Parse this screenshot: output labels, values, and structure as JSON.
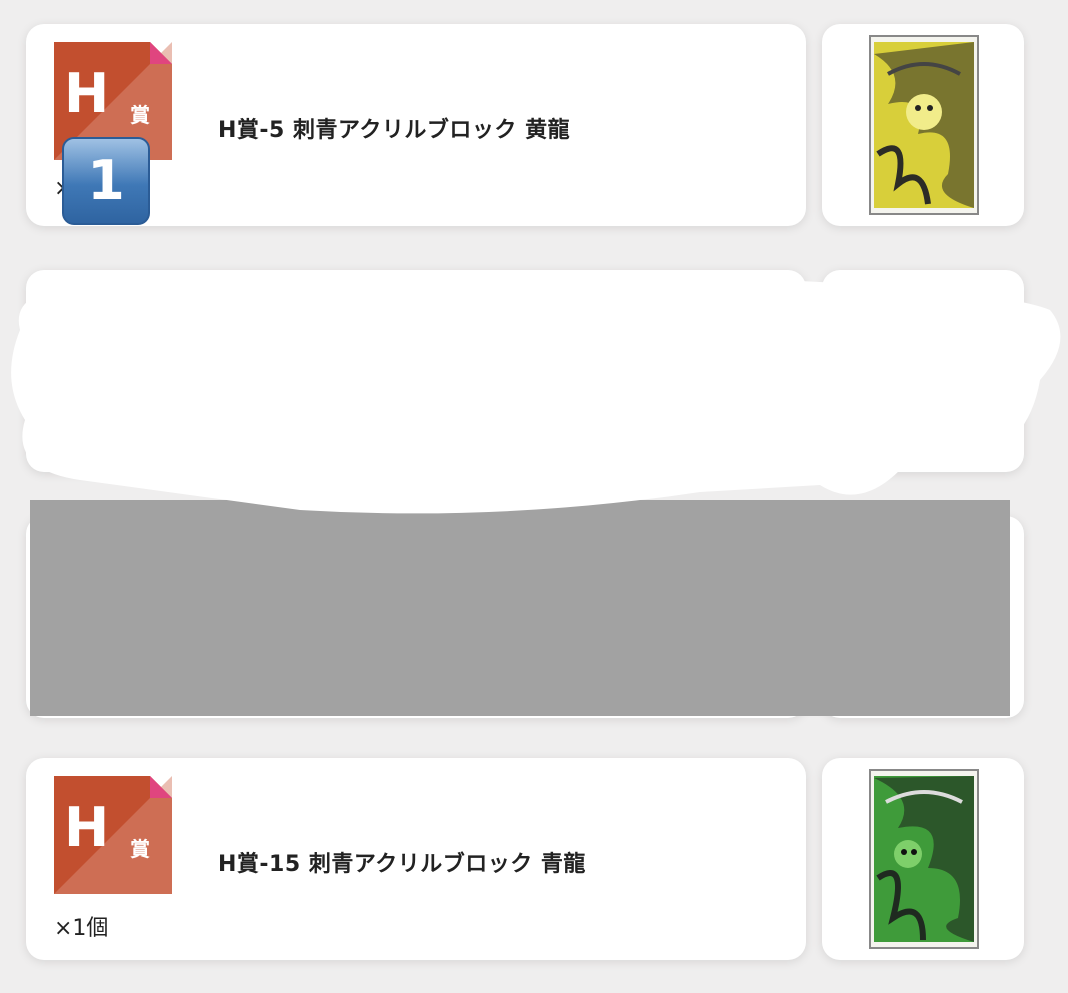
{
  "items": [
    {
      "icon_letter": "H",
      "icon_sub": "賞",
      "title": "H賞-5 刺青アクリルブロック 黄龍",
      "quantity": "",
      "quantity_visible_fragment": "×",
      "emoji_badge": "1",
      "art_icon": "yellow-dragon-acrylic-block",
      "art_colors": {
        "main": "#d8cf3a",
        "dark": "#2c2c26"
      }
    },
    {
      "redacted": true
    },
    {
      "redacted": true
    },
    {
      "icon_letter": "H",
      "icon_sub": "賞",
      "title": "H賞-15 刺青アクリルブロック 青龍",
      "quantity": "×1個",
      "art_icon": "green-dragon-acrylic-block",
      "art_colors": {
        "main": "#3f9b3a",
        "dark": "#1f2a20"
      }
    }
  ],
  "colors": {
    "icon_main": "#c24f2f",
    "icon_light": "#d98872",
    "icon_corner": "#e0457f",
    "background": "#efeeee",
    "redaction_gray": "#a2a2a2"
  }
}
